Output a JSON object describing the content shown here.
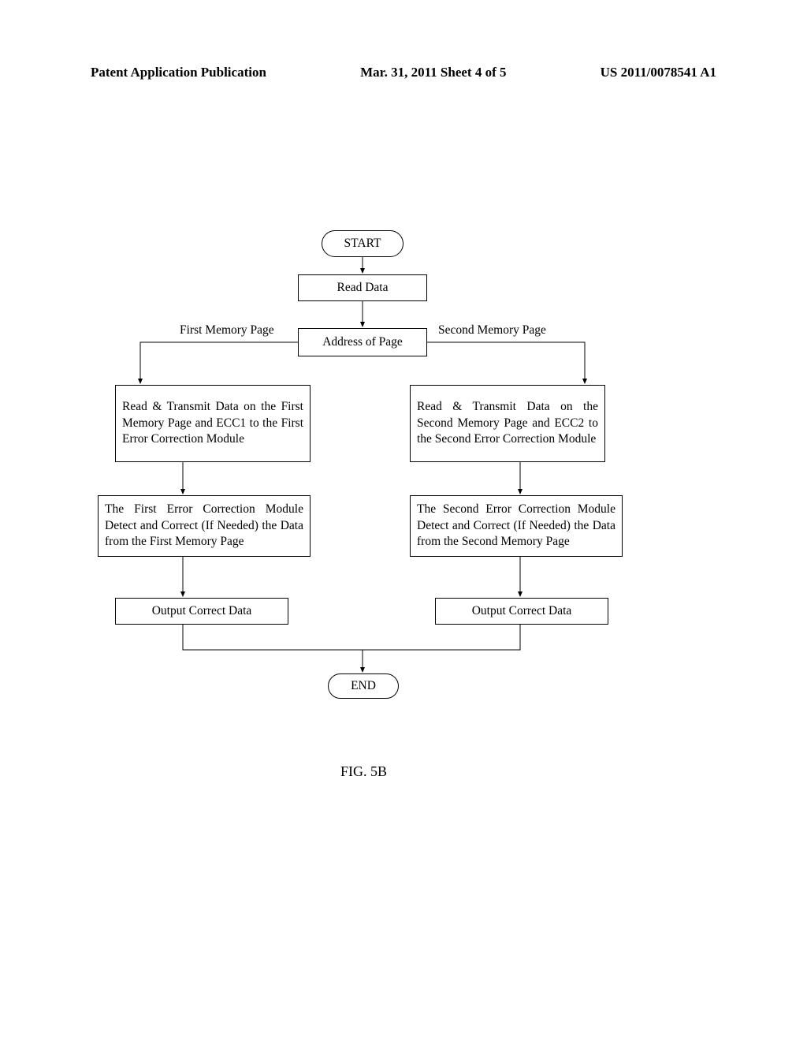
{
  "header": {
    "left": "Patent Application Publication",
    "center": "Mar. 31, 2011  Sheet 4 of 5",
    "right": "US 2011/0078541 A1"
  },
  "flow": {
    "start": "START",
    "read_data": "Read Data",
    "address": "Address of Page",
    "branch_left_label": "First Memory Page",
    "branch_right_label": "Second Memory Page",
    "left_step1": "Read & Transmit Data on the First Memory Page and ECC1 to the First Error Correction Module",
    "left_step2": "The First Error Correction Module Detect and Correct (If Needed) the Data from the First Memory Page",
    "left_step3": "Output Correct Data",
    "right_step1": "Read & Transmit Data on the Second Memory Page and ECC2 to the Second Error Correction Module",
    "right_step2": "The Second Error Correction Module Detect and Correct (If Needed) the Data from the Second Memory Page",
    "right_step3": "Output Correct Data",
    "end": "END"
  },
  "figure_label": "FIG. 5B"
}
